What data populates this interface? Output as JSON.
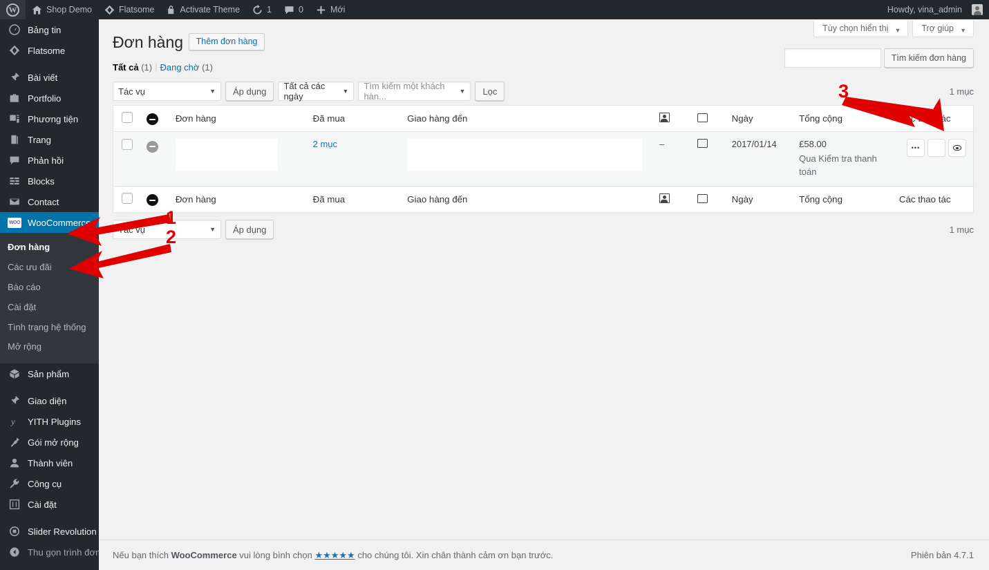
{
  "adminbar": {
    "logo_icon": "wordpress-logo-icon",
    "items": [
      {
        "label": "Shop Demo",
        "icon": "home-icon"
      },
      {
        "label": "Flatsome",
        "icon": "flatsome-diamond-icon"
      },
      {
        "label": "Activate Theme",
        "icon": "lock-icon"
      },
      {
        "label": "1",
        "icon": "updates-icon"
      },
      {
        "label": "0",
        "icon": "comment-bubble-icon"
      },
      {
        "label": "Mới",
        "icon": "plus-icon"
      }
    ],
    "greeting": "Howdy, vina_admin"
  },
  "sidebar": {
    "items": [
      {
        "label": "Bảng tin",
        "icon": "dashboard-icon",
        "type": "item"
      },
      {
        "label": "Flatsome",
        "icon": "flatsome-diamond-icon",
        "type": "item"
      },
      {
        "type": "separator"
      },
      {
        "label": "Bài viết",
        "icon": "pin-icon",
        "type": "item"
      },
      {
        "label": "Portfolio",
        "icon": "portfolio-icon",
        "type": "item"
      },
      {
        "label": "Phương tiện",
        "icon": "media-icon",
        "type": "item"
      },
      {
        "label": "Trang",
        "icon": "pages-icon",
        "type": "item"
      },
      {
        "label": "Phản hồi",
        "icon": "comment-bubble-icon",
        "type": "item"
      },
      {
        "label": "Blocks",
        "icon": "blocks-icon",
        "type": "item"
      },
      {
        "label": "Contact",
        "icon": "envelope-icon",
        "type": "item"
      },
      {
        "label": "WooCommerce",
        "icon": "woocommerce-icon",
        "type": "item",
        "active": true
      },
      {
        "label": "Sản phẩm",
        "icon": "product-box-icon",
        "type": "item"
      },
      {
        "type": "separator"
      },
      {
        "label": "Giao diện",
        "icon": "appearance-brush-icon",
        "type": "item"
      },
      {
        "label": "YITH Plugins",
        "icon": "yith-icon",
        "type": "item"
      },
      {
        "label": "Gói mở rộng",
        "icon": "plugin-plug-icon",
        "type": "item"
      },
      {
        "label": "Thành viên",
        "icon": "users-icon",
        "type": "item"
      },
      {
        "label": "Công cụ",
        "icon": "wrench-icon",
        "type": "item"
      },
      {
        "label": "Cài đặt",
        "icon": "settings-sliders-icon",
        "type": "item"
      },
      {
        "type": "separator"
      },
      {
        "label": "Slider Revolution",
        "icon": "slider-revolution-icon",
        "type": "item"
      },
      {
        "label": "Thu gọn trình đơn",
        "icon": "collapse-arrow-icon",
        "type": "collapse"
      }
    ],
    "submenu": [
      {
        "label": "Đơn hàng",
        "current": true
      },
      {
        "label": "Các ưu đãi",
        "current": false
      },
      {
        "label": "Báo cáo",
        "current": false
      },
      {
        "label": "Cài đặt",
        "current": false
      },
      {
        "label": "Tình trạng hệ thống",
        "current": false
      },
      {
        "label": "Mở rộng",
        "current": false
      }
    ]
  },
  "screen_meta": {
    "screen_options_label": "Tùy chọn hiển thị",
    "help_label": "Trợ giúp",
    "caret": "▼"
  },
  "page": {
    "title": "Đơn hàng",
    "add_new_label": "Thêm đơn hàng"
  },
  "search": {
    "value": "",
    "placeholder": "",
    "button_label": "Tìm kiếm đơn hàng"
  },
  "views": {
    "all_label": "Tất cả",
    "all_count": "(1)",
    "separator": "|",
    "pending_label": "Đang chờ",
    "pending_count": "(1)"
  },
  "tablenav_top": {
    "bulk_action_value": "Tác vụ",
    "apply_label": "Áp dụng",
    "date_filter_value": "Tất cả các ngày",
    "customer_filter_placeholder": "Tìm kiếm một khách hàn...",
    "filter_label": "Lọc",
    "displaying_num": "1 mục",
    "arrow": "▼"
  },
  "tablenav_bottom": {
    "bulk_action_value": "Tác vụ",
    "apply_label": "Áp dụng",
    "displaying_num": "1 mục",
    "arrow": "▼"
  },
  "table": {
    "columns": {
      "order": "Đơn hàng",
      "purchased": "Đã mua",
      "ship_to": "Giao hàng đến",
      "note_icon": "order-note-icon",
      "template_icon": "screen-icon",
      "date": "Ngày",
      "total": "Tổng cộng",
      "actions": "Các thao tác"
    },
    "rows": [
      {
        "status_icon": "pending-status-icon",
        "order": "",
        "purchased": "2 mục",
        "ship_to": "",
        "note": "–",
        "date": "2017/01/14",
        "total_amount": "£58.00",
        "total_method": "Qua Kiểm tra thanh toán",
        "actions": [
          {
            "icon": "more-dots-icon"
          },
          {
            "icon": "blank-action-icon"
          },
          {
            "icon": "eye-preview-icon"
          }
        ]
      }
    ]
  },
  "footer": {
    "text_before": "Nếu bạn thích ",
    "brand": "WooCommerce",
    "text_middle": " vui lòng bình chọn ",
    "stars": "★★★★★",
    "text_after": " cho chúng tôi. Xin chân thành cảm ơn bạn trước.",
    "version": "Phiên bản 4.7.1"
  },
  "annotations": [
    {
      "number": "1",
      "target": "WooCommerce"
    },
    {
      "number": "2",
      "target": "Đơn hàng"
    },
    {
      "number": "3",
      "target": "preview-action-button"
    }
  ],
  "colors": {
    "accent": "#0073aa",
    "link": "#2271b1",
    "adminbar_bg": "#23282d",
    "annotation_red": "#e00000"
  }
}
